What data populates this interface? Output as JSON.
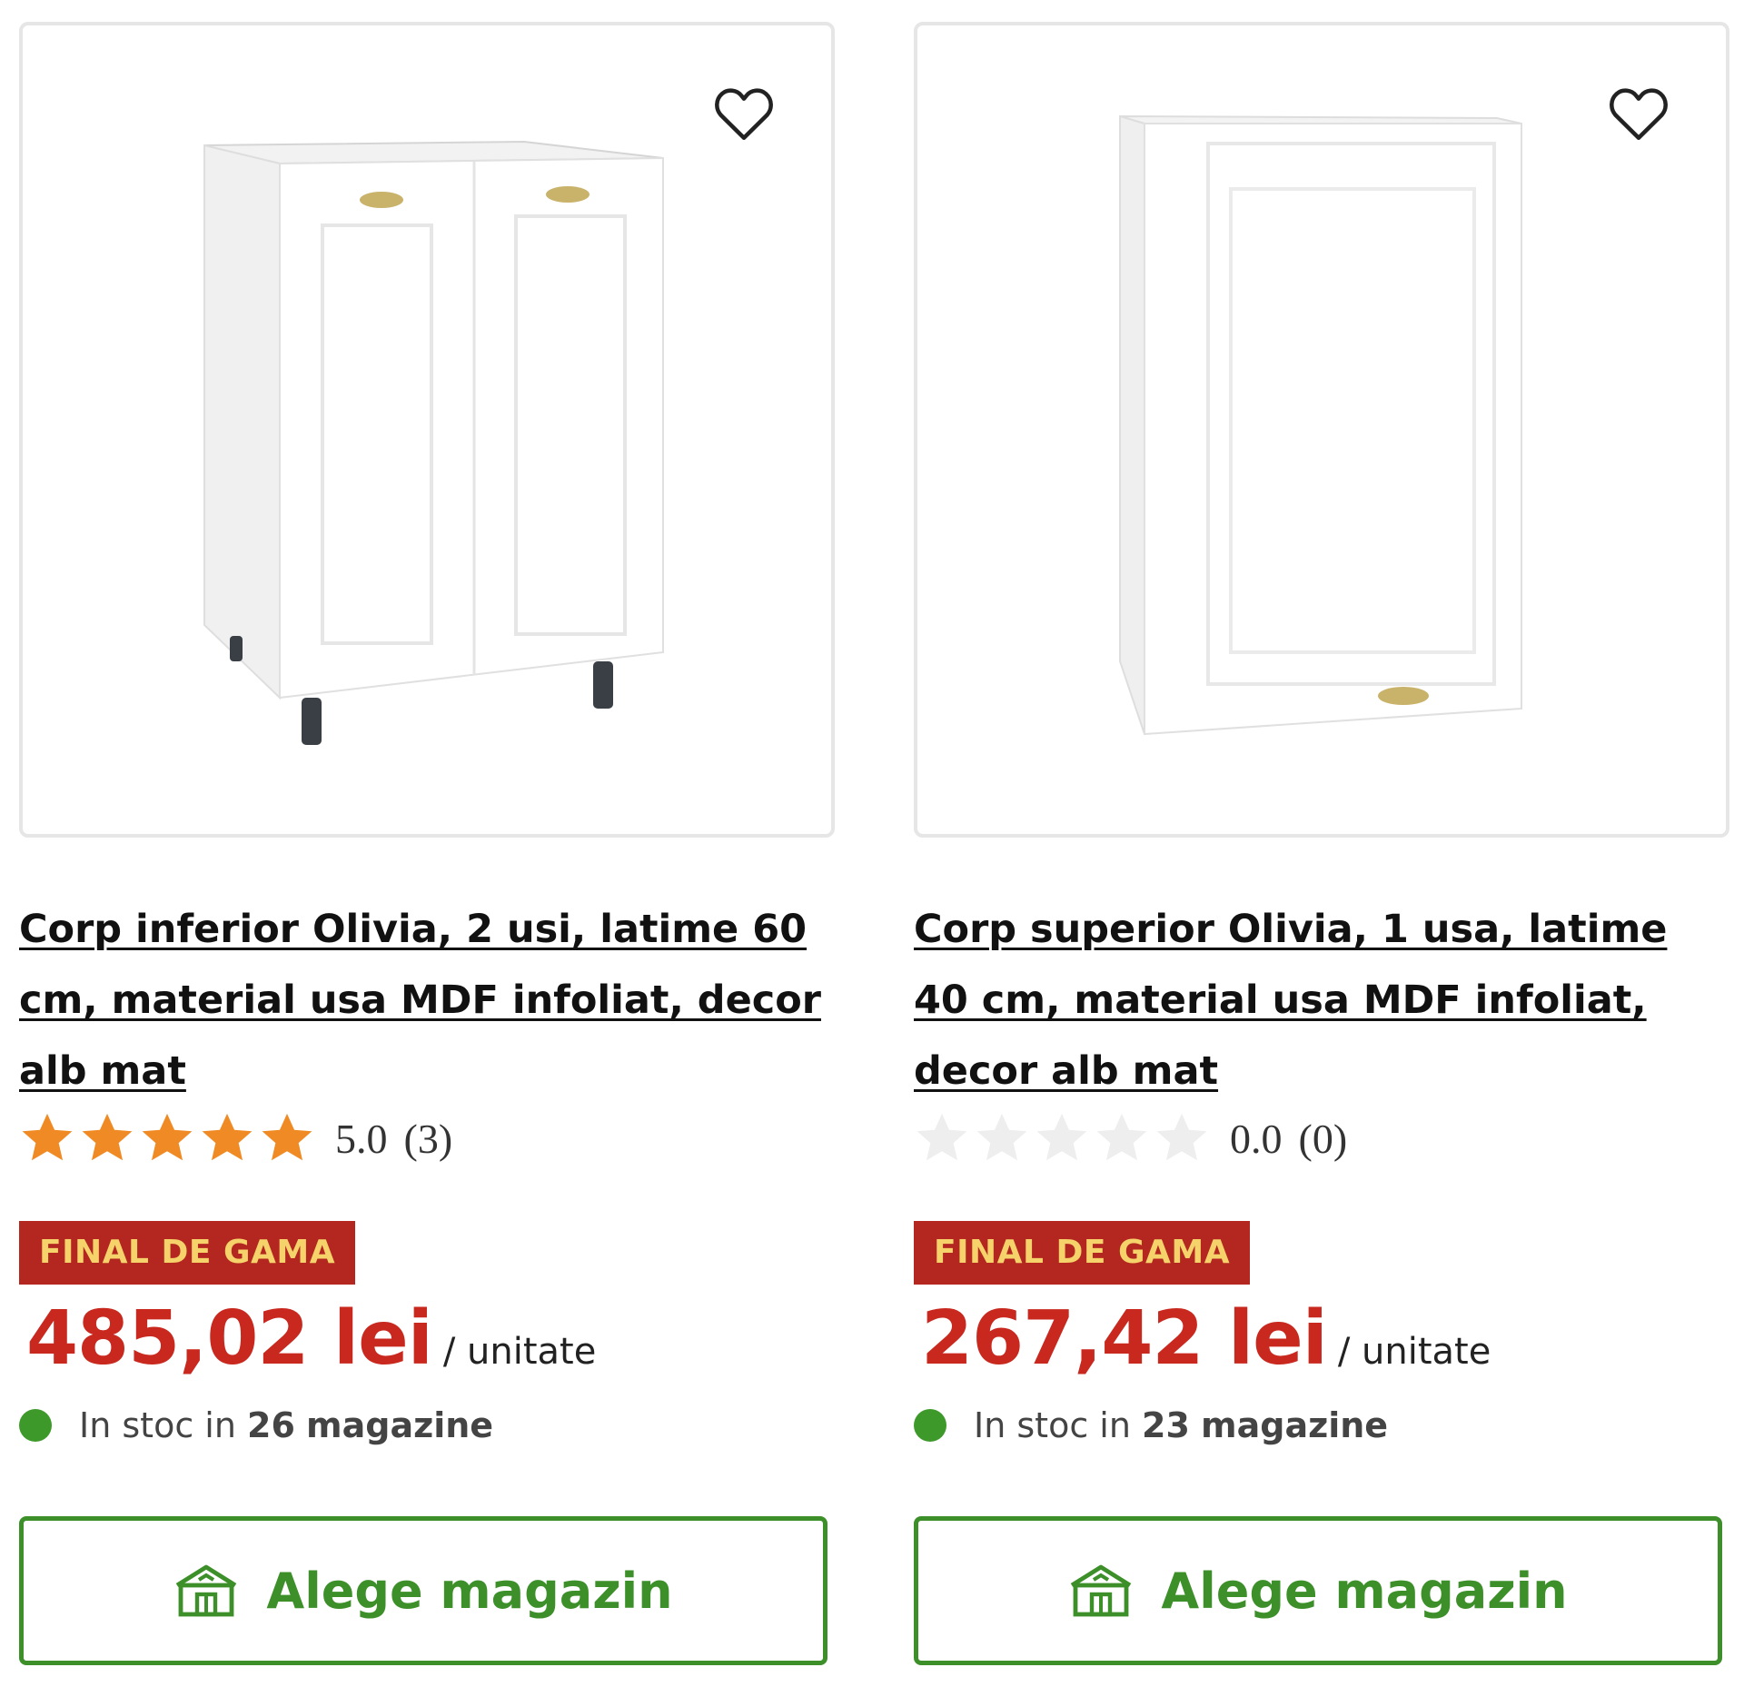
{
  "products": [
    {
      "title": "Corp inferior Olivia, 2 usi, latime 60 cm, material usa MDF infoliat, decor alb mat",
      "rating": {
        "value": "5.0",
        "count": "(3)",
        "stars": 5
      },
      "badge": "FINAL DE GAMA",
      "price": "485,02 lei",
      "unit": "/ unitate",
      "stock": {
        "prefix": "In stoc in",
        "count": "26",
        "suffix": "magazine"
      },
      "button_label": "Alege magazin"
    },
    {
      "title": "Corp superior Olivia, 1 usa, latime 40 cm, material usa MDF infoliat, decor alb mat",
      "rating": {
        "value": "0.0",
        "count": "(0)",
        "stars": 0
      },
      "badge": "FINAL DE GAMA",
      "price": "267,42 lei",
      "unit": "/ unitate",
      "stock": {
        "prefix": "In stoc in",
        "count": "23",
        "suffix": "magazine"
      },
      "button_label": "Alege magazin"
    }
  ],
  "colors": {
    "price": "#c8281e",
    "badge_bg": "#b32720",
    "badge_text": "#f6d36a",
    "star_filled": "#f08a24",
    "star_empty": "#eeeeee",
    "stock_dot": "#3d9a2a",
    "button": "#3d8f2a"
  },
  "icons": {
    "favorite": "heart-outline-icon",
    "store": "store-house-icon",
    "star": "star-icon"
  }
}
